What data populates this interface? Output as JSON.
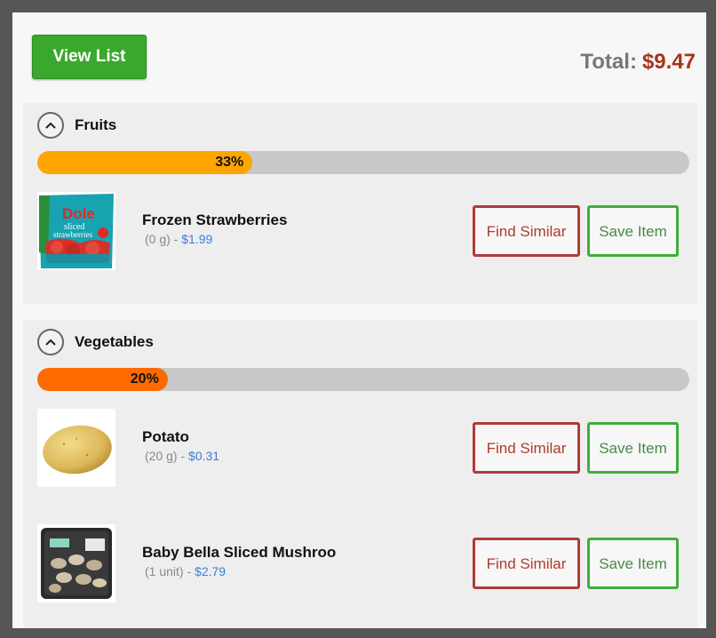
{
  "header": {
    "view_list_label": "View List",
    "total_label": "Total:",
    "total_amount": "$9.47"
  },
  "colors": {
    "accent_green": "#3aa82c",
    "total_red": "#a8341a",
    "fruits_progress": "#ffa500",
    "vegetables_progress": "#ff6a00",
    "price_blue": "#3b7ddd"
  },
  "sections": [
    {
      "title": "Fruits",
      "icon": "chevron-up-icon",
      "progress_label": "33%",
      "progress_value": 0.33,
      "items": [
        {
          "name": "Frozen Strawberries",
          "qty": "(0 g)",
          "separator": " - ",
          "price": "$1.99",
          "image": "dole-strawberries-bag",
          "image_text": [
            "Dole",
            "sliced",
            "strawberries"
          ],
          "find_similar_label": "Find Similar",
          "save_label": "Save Item"
        }
      ]
    },
    {
      "title": "Vegetables",
      "icon": "chevron-up-icon",
      "progress_label": "20%",
      "progress_value": 0.2,
      "items": [
        {
          "name": "Potato",
          "qty": "(20 g)",
          "separator": " - ",
          "price": "$0.31",
          "image": "potato",
          "find_similar_label": "Find Similar",
          "save_label": "Save Item"
        },
        {
          "name": "Baby Bella Sliced Mushroo",
          "qty": "(1 unit)",
          "separator": " - ",
          "price": "$2.79",
          "image": "mushroom-package",
          "find_similar_label": "Find Similar",
          "save_label": "Save Item"
        }
      ]
    }
  ]
}
